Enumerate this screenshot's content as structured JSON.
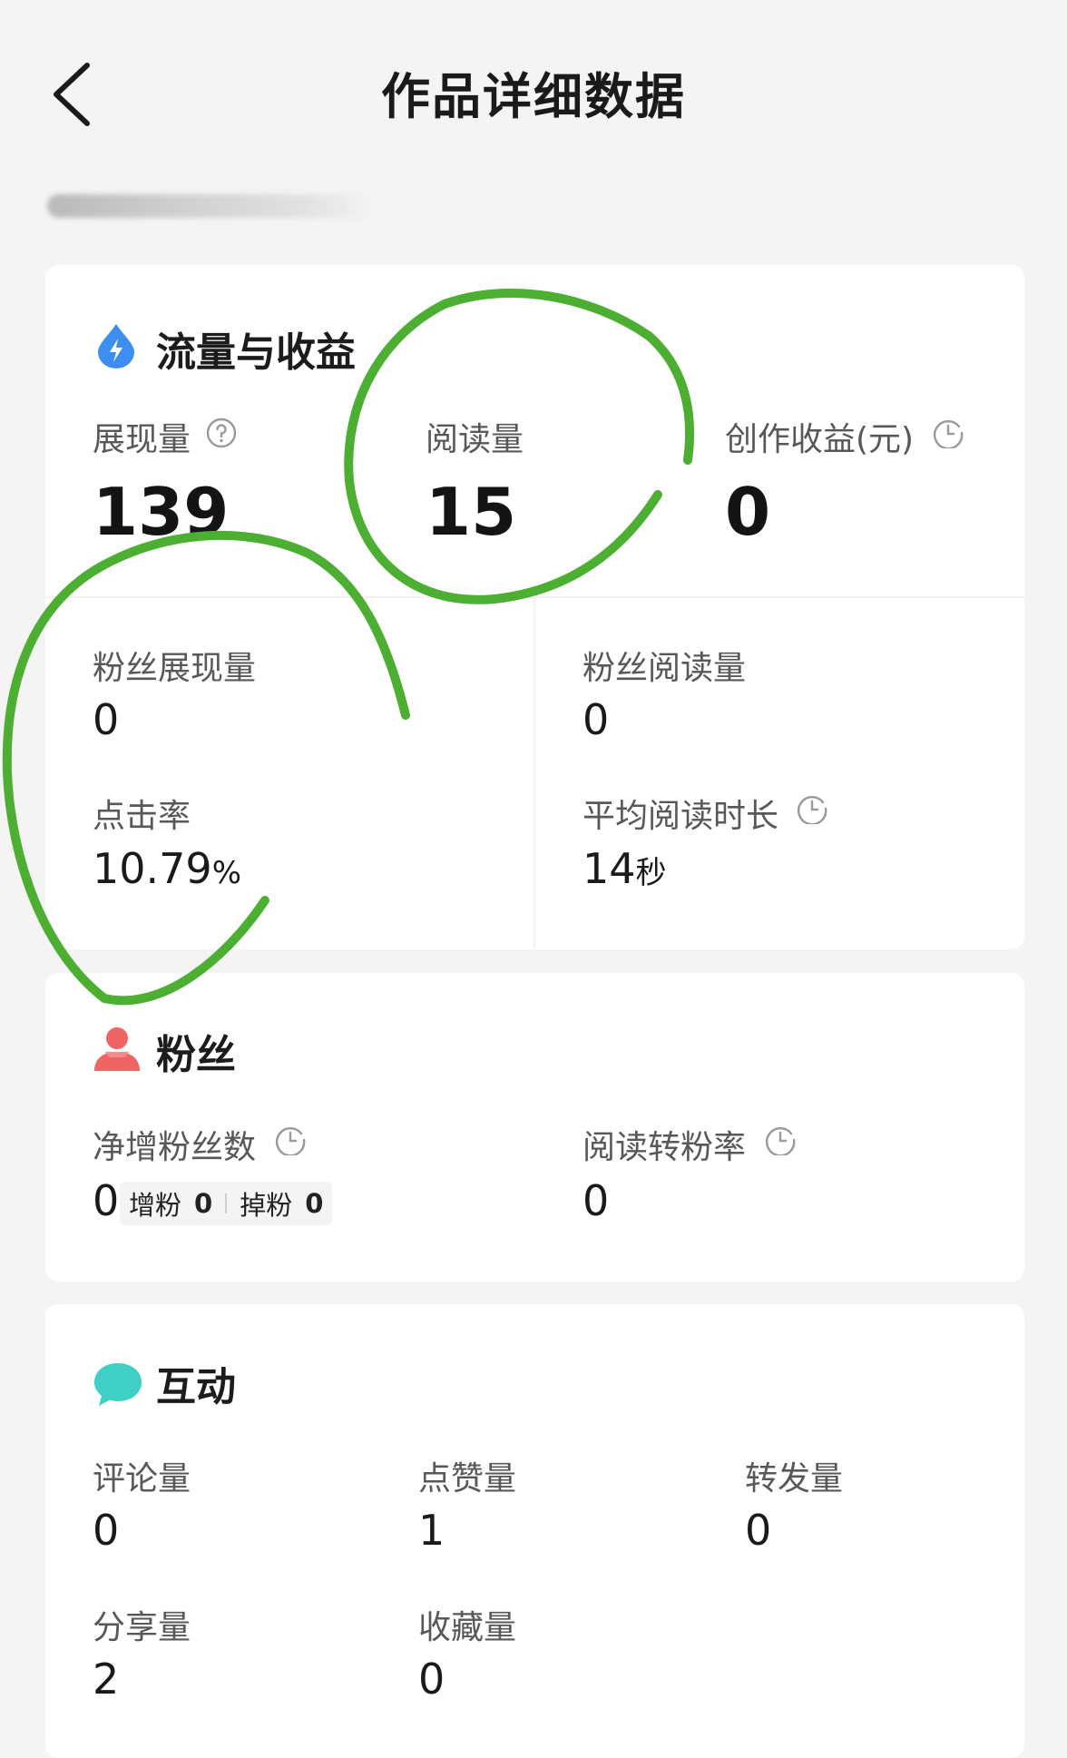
{
  "header": {
    "title": "作品详细数据"
  },
  "traffic": {
    "title": "流量与收益",
    "impressions": {
      "label": "展现量",
      "value": "139"
    },
    "reads": {
      "label": "阅读量",
      "value": "15"
    },
    "income": {
      "label": "创作收益(元)",
      "value": "0"
    },
    "fan_impressions": {
      "label": "粉丝展现量",
      "value": "0"
    },
    "fan_reads": {
      "label": "粉丝阅读量",
      "value": "0"
    },
    "ctr": {
      "label": "点击率",
      "value": "10.79",
      "unit": "%"
    },
    "avg_read_time": {
      "label": "平均阅读时长",
      "value": "14",
      "unit": "秒"
    }
  },
  "fans": {
    "title": "粉丝",
    "net_gain": {
      "label": "净增粉丝数",
      "value": "0",
      "gain_label": "增粉",
      "gain_value": "0",
      "loss_label": "掉粉",
      "loss_value": "0"
    },
    "conversion": {
      "label": "阅读转粉率",
      "value": "0"
    }
  },
  "interaction": {
    "title": "互动",
    "comments": {
      "label": "评论量",
      "value": "0"
    },
    "likes": {
      "label": "点赞量",
      "value": "1"
    },
    "forwards": {
      "label": "转发量",
      "value": "0"
    },
    "shares": {
      "label": "分享量",
      "value": "2"
    },
    "favorites": {
      "label": "收藏量",
      "value": "0"
    }
  },
  "colors": {
    "annotation": "#4caf32",
    "traffic_icon": "#3d8ef0",
    "fans_icon": "#ef6464",
    "interaction_icon": "#3fcfc4"
  }
}
